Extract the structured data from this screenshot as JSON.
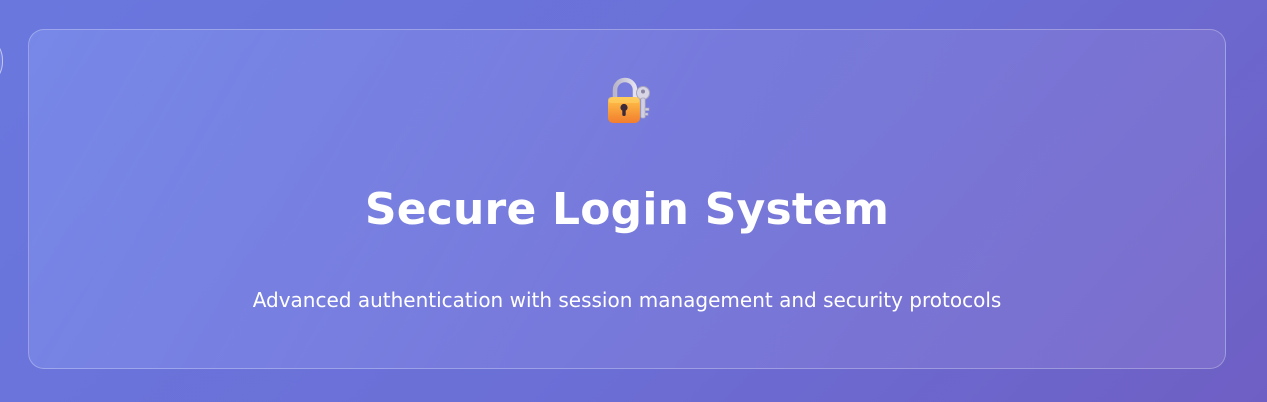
{
  "header": {
    "icon": "lock-with-key-icon",
    "title": "Secure Login System",
    "subtitle": "Advanced authentication with session management and security protocols"
  },
  "colors": {
    "background_start": "#6a78de",
    "background_end": "#6e5fc4",
    "text": "#ffffff",
    "lock_body": "#f7a23a",
    "key": "#c9c6dc"
  }
}
